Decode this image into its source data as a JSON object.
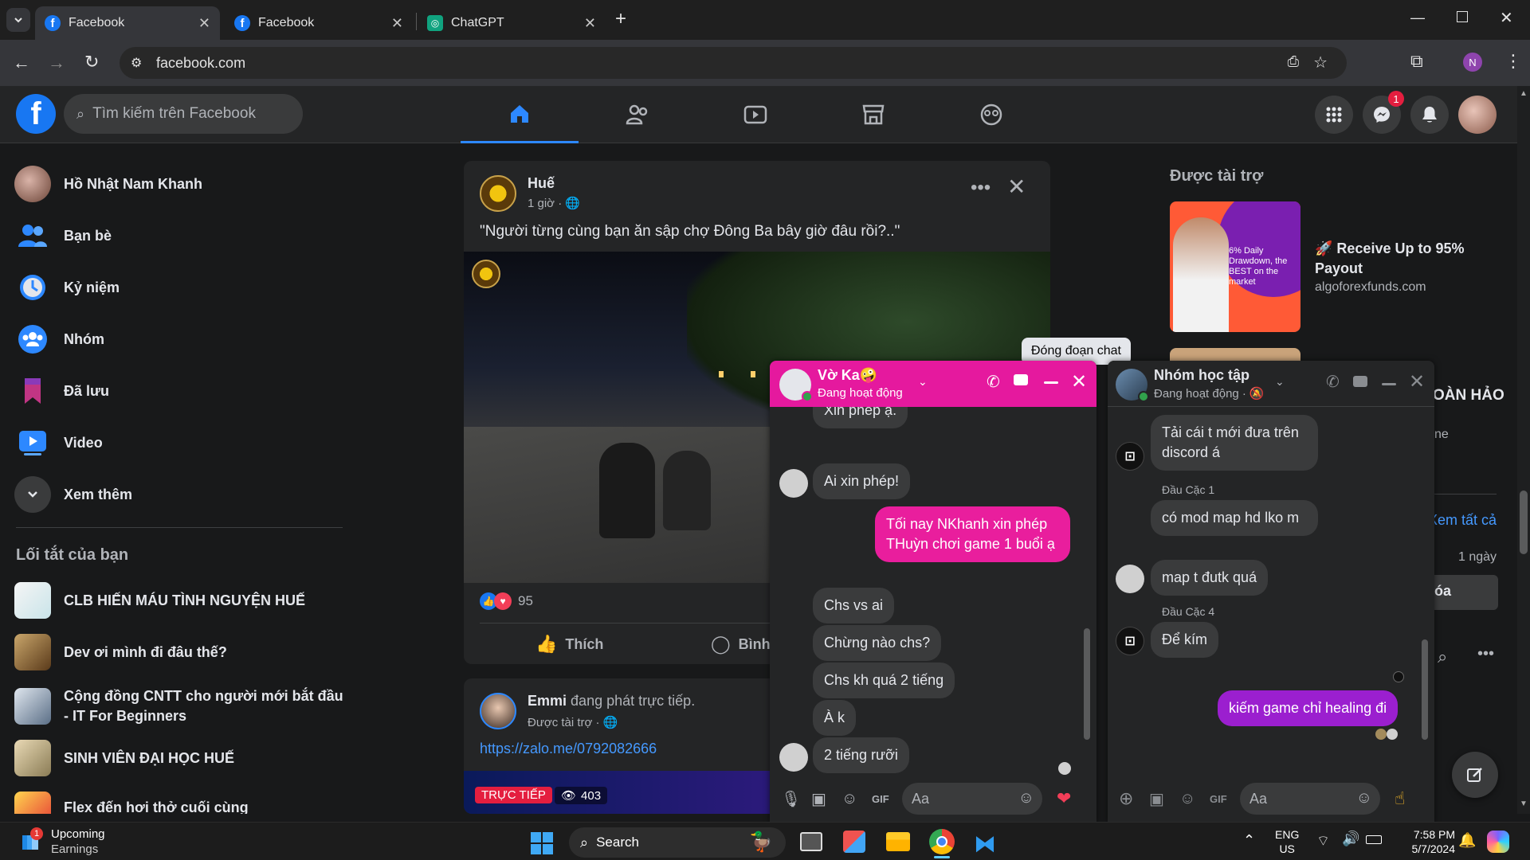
{
  "browser": {
    "tabs": [
      {
        "title": "Facebook",
        "active": true
      },
      {
        "title": "Facebook",
        "active": false
      },
      {
        "title": "ChatGPT",
        "active": false
      }
    ],
    "url": "facebook.com",
    "profile_initial": "N"
  },
  "header": {
    "search_placeholder": "Tìm kiếm trên Facebook",
    "messenger_badge": "1"
  },
  "sidebar": {
    "items": [
      {
        "label": "Hồ Nhật Nam Khanh"
      },
      {
        "label": "Bạn bè"
      },
      {
        "label": "Kỷ niệm"
      },
      {
        "label": "Nhóm"
      },
      {
        "label": "Đã lưu"
      },
      {
        "label": "Video"
      },
      {
        "label": "Xem thêm"
      }
    ],
    "shortcuts_title": "Lối tắt của bạn",
    "shortcuts": [
      {
        "label": "CLB HIẾN MÁU TÌNH NGUYỆN HUẾ"
      },
      {
        "label": "Dev ơi mình đi đâu thế?"
      },
      {
        "label": "Cộng đồng CNTT cho người mới bắt đầu - IT For Beginners"
      },
      {
        "label": "SINH VIÊN ĐẠI HỌC HUẾ"
      },
      {
        "label": "Flex đến hơi thở cuối cùng"
      }
    ]
  },
  "post1": {
    "author": "Huế",
    "time": "1 giờ ·",
    "text": "\"Người từng cùng bạn ăn sập chợ Đông Ba bây giờ đâu rồi?..\"",
    "reaction_count": "95",
    "like_label": "Thích",
    "comment_label": "Bình"
  },
  "post2": {
    "author": "Emmi",
    "action": "đang phát trực tiếp.",
    "sponsored": "Được tài trợ ·",
    "link": "https://zalo.me/0792082666",
    "live_label": "TRỰC TIẾP",
    "viewers": "403"
  },
  "right": {
    "sponsored_title": "Được tài trợ",
    "ad_title": "🚀 Receive Up to 95% Payout",
    "ad_domain": "algoforexfunds.com",
    "ad_image_text": "6% Daily Drawdown, the BEST on the market",
    "partial_hoan_hao": "OÀN HẢO",
    "partial_he": "ne",
    "partial_xem_tat_ca": "Xem tất cả",
    "partial_1_ngay": "1 ngày",
    "partial_xoa": "óa"
  },
  "tooltip": "Đóng đoạn chat",
  "chat1": {
    "name": "Vờ Ka🤪",
    "status": "Đang hoạt động",
    "messages": [
      {
        "text": "Xin phép ạ.",
        "from": "them"
      },
      {
        "text": "Ai xin phép!",
        "from": "them"
      },
      {
        "text": "Tối nay NKhanh xin phép THuỳn chơi game 1 buổi ạ",
        "from": "me"
      },
      {
        "text": "Chs vs ai",
        "from": "them"
      },
      {
        "text": "Chừng nào chs?",
        "from": "them"
      },
      {
        "text": "Chs kh quá 2 tiếng",
        "from": "them"
      },
      {
        "text": "À k",
        "from": "them"
      },
      {
        "text": "2 tiếng rưỡi",
        "from": "them"
      }
    ],
    "input_placeholder": "Aa"
  },
  "chat2": {
    "name": "Nhóm học tập",
    "status": "Đang hoạt động ·",
    "messages": [
      {
        "text": "Tải cái t mới đưa trên discord á",
        "from": "them"
      },
      {
        "sender": "Đầu Cặc 1",
        "text": "có mod map hd lko m",
        "from": "them"
      },
      {
        "text": "map t đutk quá",
        "from": "them"
      },
      {
        "sender": "Đầu Cặc 4",
        "text": "Để kím",
        "from": "them"
      },
      {
        "text": "kiếm game chỉ healing đi",
        "from": "me"
      }
    ],
    "input_placeholder": "Aa"
  },
  "taskbar": {
    "weather_badge": "1",
    "weather_title": "Upcoming",
    "weather_sub": "Earnings",
    "search_label": "Search",
    "lang_top": "ENG",
    "lang_bottom": "US",
    "time": "7:58 PM",
    "date": "5/7/2024"
  }
}
